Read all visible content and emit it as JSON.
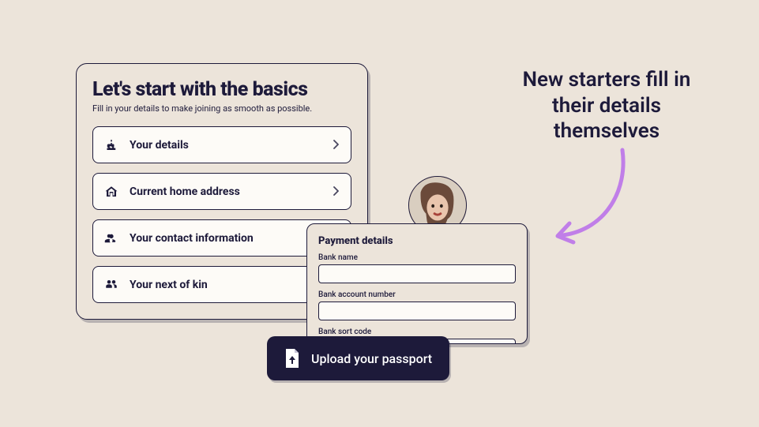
{
  "basics": {
    "title": "Let's start with the basics",
    "subtitle": "Fill in your details to make joining as smooth as possible.",
    "items": [
      {
        "label": "Your details"
      },
      {
        "label": "Current home address"
      },
      {
        "label": "Your contact information"
      },
      {
        "label": "Your next of kin"
      }
    ]
  },
  "payment": {
    "title": "Payment details",
    "bank_name_label": "Bank name",
    "bank_account_label": "Bank account number",
    "bank_sort_label": "Bank sort code"
  },
  "upload": {
    "label": "Upload your passport"
  },
  "promo": {
    "text": "New starters fill in their details themselves"
  },
  "colors": {
    "ink": "#1d1a3a",
    "bg": "#ece4da",
    "accent": "#c07ee8"
  }
}
